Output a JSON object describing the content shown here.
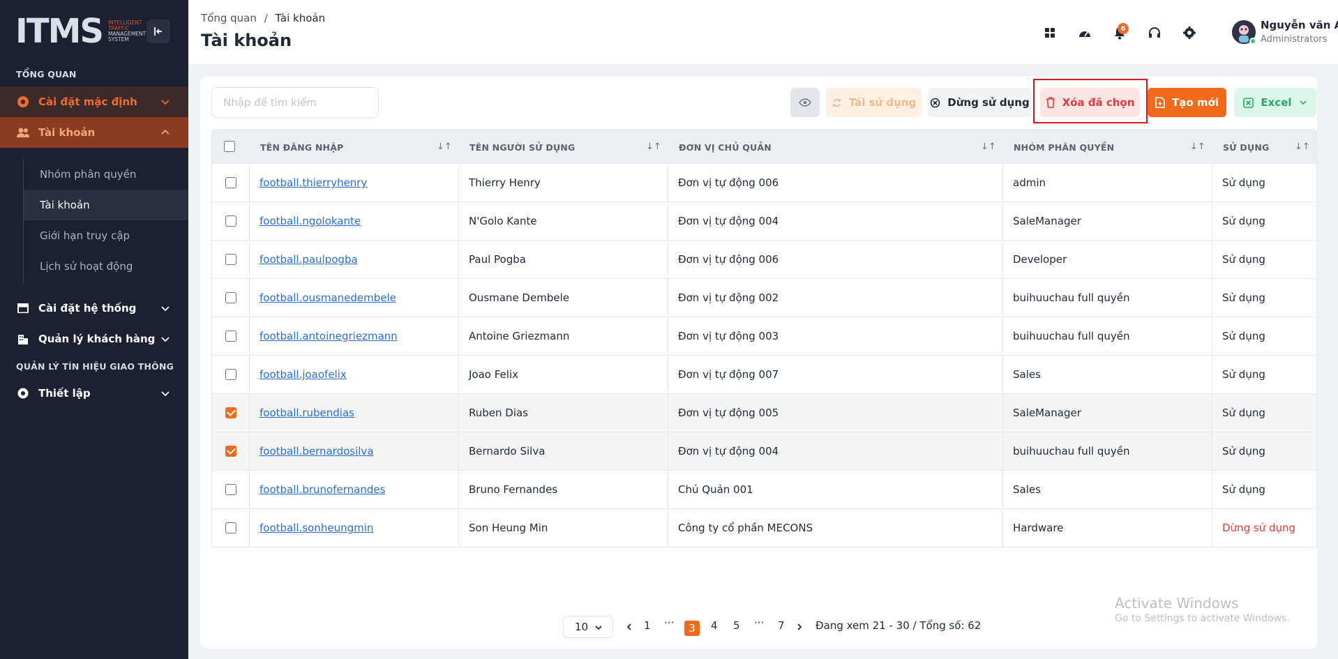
{
  "app": {
    "logo_text": "ITMS",
    "logo_sub": [
      "INTELLIGENT",
      "TRAFFIC",
      "MANAGEMENT",
      "SYSTEM"
    ]
  },
  "sidebar": {
    "section_overview": "TỔNG QUAN",
    "section_traffic": "QUẢN LÝ TÍN HIỆU GIAO THÔNG",
    "items": [
      {
        "label": "Cài đặt mặc định",
        "icon": "gear-badge-icon"
      },
      {
        "label": "Tài khoản",
        "icon": "users-icon"
      },
      {
        "label": "Cài đặt hệ thống",
        "icon": "window-icon"
      },
      {
        "label": "Quản lý khách hàng",
        "icon": "building-icon"
      },
      {
        "label": "Thiết lập",
        "icon": "settings-icon"
      }
    ],
    "sub_items": [
      {
        "label": "Nhóm phân quyền"
      },
      {
        "label": "Tài khoản"
      },
      {
        "label": "Giới hạn truy cập"
      },
      {
        "label": "Lịch sử hoạt động"
      }
    ]
  },
  "header": {
    "breadcrumb_root": "Tổng quan",
    "breadcrumb_sep": "/",
    "breadcrumb_current": "Tài khoản",
    "title": "Tài khoản",
    "notification_count": "6",
    "user_name": "Nguyễn văn A",
    "user_role": "Administrators"
  },
  "toolbar": {
    "search_placeholder": "Nhập để tìm kiếm",
    "reuse_label": "Tái sử dụng",
    "stop_label": "Dừng sử dụng",
    "delete_label": "Xóa đã chọn",
    "create_label": "Tạo mới",
    "excel_label": "Excel"
  },
  "table": {
    "columns": [
      "TÊN ĐĂNG NHẬP",
      "TÊN NGƯỜI SỬ DỤNG",
      "ĐƠN VỊ CHỦ QUẢN",
      "NHÓM PHÂN QUYỀN",
      "SỬ DỤNG"
    ],
    "rows": [
      {
        "username": "football.thierryhenry",
        "name": "Thierry Henry",
        "unit": "Đơn vị tự động 006",
        "group": "admin",
        "status": "Sử dụng",
        "checked": false
      },
      {
        "username": "football.ngolokante",
        "name": "N'Golo Kante",
        "unit": "Đơn vị tự động 004",
        "group": "SaleManager",
        "status": "Sử dụng",
        "checked": false
      },
      {
        "username": "football.paulpogba",
        "name": "Paul Pogba",
        "unit": "Đơn vị tự động 006",
        "group": "Developer",
        "status": "Sử dụng",
        "checked": false
      },
      {
        "username": "football.ousmanedembele",
        "name": "Ousmane Dembele",
        "unit": "Đơn vị tự động 002",
        "group": "buihuuchau full quyền",
        "status": "Sử dụng",
        "checked": false
      },
      {
        "username": "football.antoinegriezmann",
        "name": "Antoine Griezmann",
        "unit": "Đơn vị tự động 003",
        "group": "buihuuchau full quyền",
        "status": "Sử dụng",
        "checked": false
      },
      {
        "username": "football.joaofelix",
        "name": "Joao Felix",
        "unit": "Đơn vị tự động 007",
        "group": "Sales",
        "status": "Sử dụng",
        "checked": false
      },
      {
        "username": "football.rubendias",
        "name": "Ruben Dias",
        "unit": "Đơn vị tự động 005",
        "group": "SaleManager",
        "status": "Sử dụng",
        "checked": true
      },
      {
        "username": "football.bernardosilva",
        "name": "Bernardo Silva",
        "unit": "Đơn vị tự động 004",
        "group": "buihuuchau full quyền",
        "status": "Sử dụng",
        "checked": true
      },
      {
        "username": "football.brunofernandes",
        "name": "Bruno Fernandes",
        "unit": "Chủ Quản 001",
        "group": "Sales",
        "status": "Sử dụng",
        "checked": false
      },
      {
        "username": "football.sonheungmin",
        "name": "Son Heung Min",
        "unit": "Công ty cổ phần MECONS",
        "group": "Hardware",
        "status": "Dừng sử dụng",
        "checked": false
      }
    ]
  },
  "pagination": {
    "page_size": "10",
    "pages": [
      "1",
      "···",
      "3",
      "4",
      "5",
      "···",
      "7"
    ],
    "current": "3",
    "summary": "Đang xem 21 - 30 / Tổng số: 62"
  },
  "watermark": {
    "line1": "Activate Windows",
    "line2": "Go to Settings to activate Windows."
  },
  "colors": {
    "accent": "#f06a1b",
    "sidebar_bg": "#1b2130",
    "danger": "#e23b3b",
    "success": "#29a86a",
    "link": "#2b6cd6"
  }
}
